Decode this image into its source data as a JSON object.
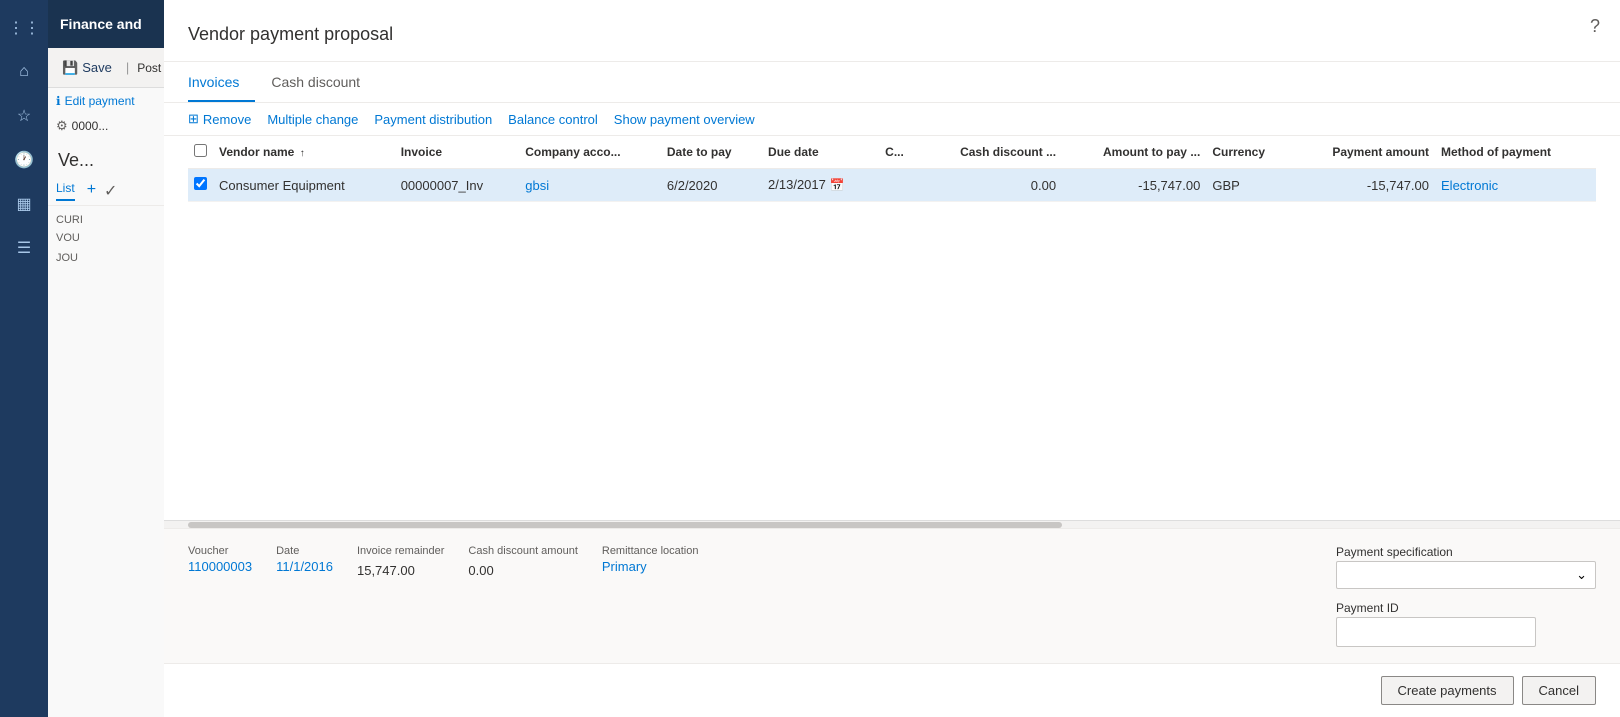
{
  "app": {
    "title": "Finance and",
    "nav_icons": [
      "grid",
      "home",
      "star",
      "clock",
      "chart",
      "list"
    ],
    "help_label": "?"
  },
  "toolbar": {
    "save_label": "Save",
    "post_label": "Post",
    "edit_payment_label": "Edit payment"
  },
  "left_panel": {
    "title": "Ve...",
    "list_label": "List",
    "cur_label": "CURI",
    "vou_label": "VOU",
    "jou_label": "JOU",
    "id_label": "0000..."
  },
  "modal": {
    "title": "Vendor payment proposal",
    "tabs": [
      {
        "id": "invoices",
        "label": "Invoices",
        "active": true
      },
      {
        "id": "cash-discount",
        "label": "Cash discount",
        "active": false
      }
    ],
    "actions": [
      {
        "id": "remove",
        "label": "Remove",
        "icon": "table-icon"
      },
      {
        "id": "multiple-change",
        "label": "Multiple change"
      },
      {
        "id": "payment-distribution",
        "label": "Payment distribution"
      },
      {
        "id": "balance-control",
        "label": "Balance control"
      },
      {
        "id": "show-payment-overview",
        "label": "Show payment overview"
      }
    ],
    "table": {
      "columns": [
        {
          "id": "vendor-name",
          "label": "Vendor name",
          "sortable": true
        },
        {
          "id": "invoice",
          "label": "Invoice"
        },
        {
          "id": "company-account",
          "label": "Company acco..."
        },
        {
          "id": "date-to-pay",
          "label": "Date to pay"
        },
        {
          "id": "due-date",
          "label": "Due date"
        },
        {
          "id": "c",
          "label": "C..."
        },
        {
          "id": "cash-discount",
          "label": "Cash discount ..."
        },
        {
          "id": "amount-to-pay",
          "label": "Amount to pay ..."
        },
        {
          "id": "currency",
          "label": "Currency"
        },
        {
          "id": "payment-amount",
          "label": "Payment amount"
        },
        {
          "id": "method-of-payment",
          "label": "Method of payment"
        }
      ],
      "rows": [
        {
          "selected": true,
          "vendor_name": "Consumer Equipment",
          "invoice": "00000007_Inv",
          "company_account": "gbsi",
          "date_to_pay": "6/2/2020",
          "due_date": "2/13/2017",
          "c": "",
          "cash_discount": "0.00",
          "amount_to_pay": "-15,747.00",
          "currency": "GBP",
          "payment_amount": "-15,747.00",
          "method_of_payment": "Electronic"
        }
      ]
    },
    "details": {
      "voucher_label": "Voucher",
      "voucher_value": "110000003",
      "date_label": "Date",
      "date_value": "11/1/2016",
      "invoice_remainder_label": "Invoice remainder",
      "invoice_remainder_value": "15,747.00",
      "cash_discount_amount_label": "Cash discount amount",
      "cash_discount_amount_value": "0.00",
      "remittance_location_label": "Remittance location",
      "remittance_location_value": "Primary",
      "payment_specification_label": "Payment specification",
      "payment_specification_value": "",
      "payment_id_label": "Payment ID",
      "payment_id_value": ""
    },
    "footer": {
      "create_payments_label": "Create payments",
      "cancel_label": "Cancel"
    }
  }
}
